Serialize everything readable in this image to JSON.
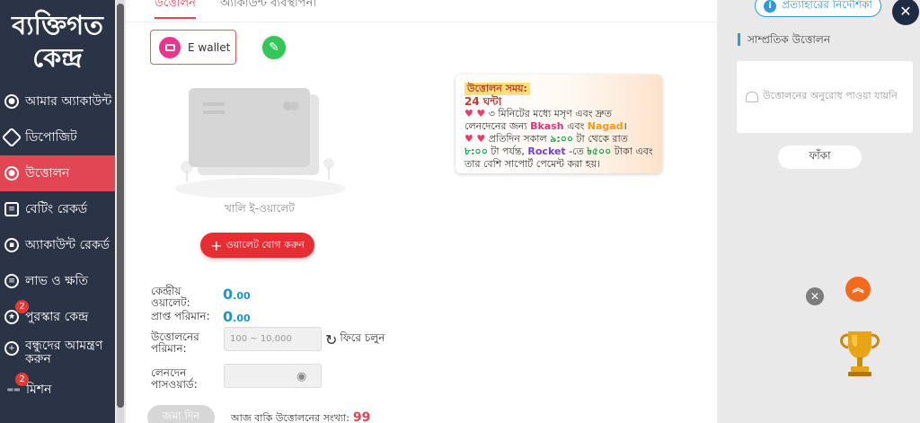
{
  "sidebar": {
    "title_line1": "ব্যক্তিগত",
    "title_line2": "কেন্দ্র",
    "items": [
      {
        "label": "আমার অ্যাকাউন্ট"
      },
      {
        "label": "ডিপোজিট"
      },
      {
        "label": "উত্তোলন"
      },
      {
        "label": "বেটিং রেকর্ড"
      },
      {
        "label": "অ্যাকাউন্ট রেকর্ড"
      },
      {
        "label": "লাভ ও ক্ষতি"
      },
      {
        "label": "পুরস্কার কেন্দ্র",
        "badge": "2"
      },
      {
        "label": "বন্ধুদের আমন্ত্রণ করুন"
      },
      {
        "label": "মিশন",
        "badge": "2"
      }
    ]
  },
  "tabs": {
    "withdraw": "উত্তোলন",
    "account": "অ্যাকাউন্ট ব্যবস্থাপনা"
  },
  "wallet": {
    "ewallet_label": "E wallet",
    "empty_text": "খালি ই-ওয়ালেট",
    "add_label": "ওয়ালেট যোগ করুন"
  },
  "info": {
    "title": "উত্তোলন সময়:",
    "hours": "24 ঘন্টা",
    "p1_pre": "৩ মিনিটের মধ্যে মসৃণ এবং দ্রুত লেনদেনের জন্য ",
    "bkash": "Bkash",
    "p1_mid": " এবং ",
    "nagad": "Nagad",
    "p1_end": "।",
    "p2_pre": "প্রতিদিন সকাল ",
    "t1": "৯:০০",
    "p2_mid": " টা থেকে রাত ",
    "t2": "৮:০০",
    "p2_mid2": " টা পর্যন্ত, ",
    "rocket": "Rocket",
    "p2_mid3": " -তে ",
    "amount": "৳৫০০",
    "p2_end": " টাকা এবং তার বেশি সাপোর্ট পেমেন্ট করা হয়।"
  },
  "form": {
    "central_wallet_label": "কেন্দ্রীয় ওয়ালেট:",
    "central_wallet_int": "0",
    "central_wallet_dec": ".00",
    "receivable_label": "প্রাপ্ত পরিমান:",
    "receivable_int": "0",
    "receivable_dec": ".00",
    "amount_label": "উত্তোলনের পরিমান:",
    "amount_placeholder": "100 ~ 10,000",
    "back_label": "ফিরে চলুন",
    "password_label": "লেনদেন পাসওয়ার্ড:",
    "deposit_button": "জমা দিন",
    "remaining_label": "আজ বাকি উত্তোলনের সংখ্যা:",
    "remaining_value": "99"
  },
  "right": {
    "guide_label": "প্রত্যাহারের নির্দেশিকা",
    "recent_title": "সাম্প্রতিক উত্তোলন",
    "recent_empty": "উত্তোলনের অনুরোধ পাওয়া যায়নি",
    "clear_label": "ফাঁকা"
  }
}
